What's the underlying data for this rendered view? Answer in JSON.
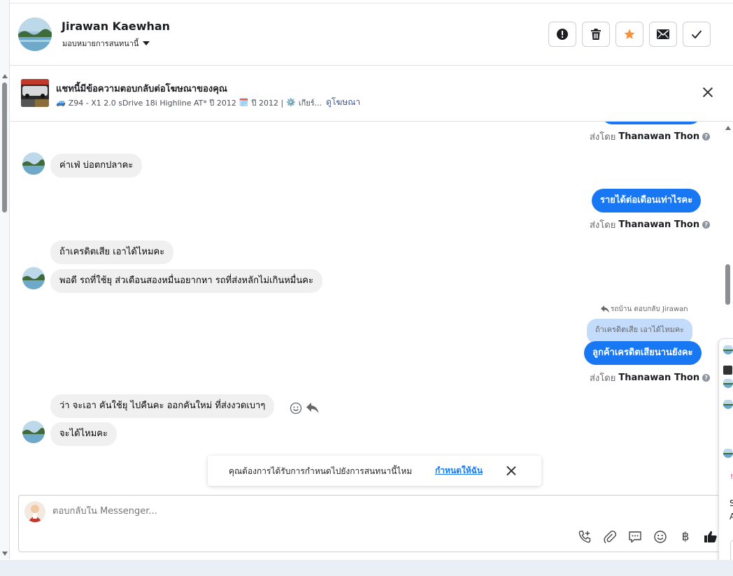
{
  "header": {
    "name": "Jirawan Kaewhan",
    "subtitle": "มอบหมายการสนทนานี้",
    "actions": [
      {
        "name": "report-button",
        "icon": "alert-icon"
      },
      {
        "name": "delete-button",
        "icon": "trash-icon"
      },
      {
        "name": "star-button",
        "icon": "star-icon",
        "color": "#f7923b"
      },
      {
        "name": "mark-unread-button",
        "icon": "mail-icon"
      },
      {
        "name": "mark-done-button",
        "icon": "check-icon"
      }
    ]
  },
  "ad": {
    "title": "แชทนี้มีข้อความตอบกลับต่อโฆษณาของคุณ",
    "car_emoji": "🚙",
    "model": "Z94 - X1 2.0 sDrive 18i Highline AT* ปี 2012",
    "calendar_emoji": "🗓️",
    "year": "ปี 2012 |",
    "gear_emoji": "⚙️",
    "gear": "เกียร์...",
    "link": "ดูโฆษณา"
  },
  "messages": {
    "sent_by_prefix": "ส่งโดย",
    "sender": "Thanawan Thon",
    "help_icon": "?",
    "incoming_1": "ค่าเฟ่  บ่อตกปลาคะ",
    "outgoing_1": "รายได้ต่อเดือนเท่าไรคะ",
    "incoming_2": "ถ้าเครดิตเสีย  เอาได้ไหมคะ",
    "incoming_3": "พอดี รถที่ใช้ยุ ส่วเดือนสองหมื่นอยากหา รถที่ส่งหลักไม่เกินหมื่นคะ",
    "reply_label": "รถบ้าน ตอบกลับ Jirawan",
    "quoted": "ถ้าเครดิตเสีย เอาได้ไหมคะ",
    "outgoing_2": "ลูกค้าเครดิตเสียนานยังคะ",
    "incoming_4": "ว่า จะเอา คันใช้ยุ  ไปคืนคะ   ออกคันใหม่ ที่ส่งงวดเบาๆ",
    "incoming_5": "จะได้ไหมคะ"
  },
  "toast": {
    "text": "คุณต้องการได้รับการกำหนดไปยังการสนทนานี้ไหม",
    "link": "กำหนดให้ฉัน"
  },
  "composer": {
    "placeholder": "ตอบกลับใน Messenger...",
    "baht_symbol": "฿",
    "tools": [
      "phone-add-icon",
      "paperclip-icon",
      "saved-reply-icon",
      "emoji-icon",
      "baht-icon",
      "thumbs-up-icon"
    ]
  },
  "side_panel": {
    "text_1": "S",
    "text_2": "A",
    "red_text": "!"
  },
  "colors": {
    "brand_blue": "#1877f2",
    "bubble_gray": "#f0f0f0",
    "quote_blue": "#c4dcfb",
    "star_orange": "#f7923b"
  }
}
